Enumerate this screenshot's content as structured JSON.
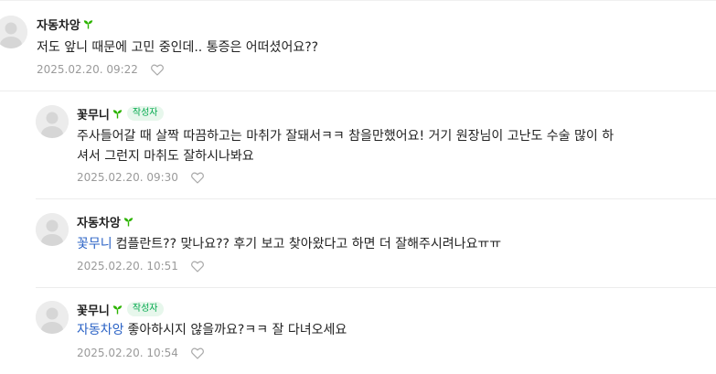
{
  "comments": [
    {
      "nickname": "자동차앙",
      "author_badge": "",
      "mention": "",
      "lines": [
        "저도 앞니 때문에 고민 중인데.. 통증은 어떠셨어요??"
      ],
      "date": "2025.02.20. 09:22"
    },
    {
      "nickname": "꽃무니",
      "author_badge": "작성자",
      "mention": "",
      "lines": [
        "주사들어갈 때 살짝 따끔하고는 마취가 잘돼서ㅋㅋ 참을만했어요! 거기 원장님이 고난도 수술 많이 하",
        "셔서 그런지 마취도 잘하시나봐요"
      ],
      "date": "2025.02.20. 09:30"
    },
    {
      "nickname": "자동차앙",
      "author_badge": "",
      "mention": "꽃무니",
      "lines": [
        "컴플란트?? 맞나요?? 후기 보고 찾아왔다고 하면 더 잘해주시려나요ㅠㅠ"
      ],
      "date": "2025.02.20. 10:51"
    },
    {
      "nickname": "꽃무니",
      "author_badge": "작성자",
      "mention": "자동차앙",
      "lines": [
        "좋아하시지 않을까요?ㅋㅋ 잘 다녀오세요"
      ],
      "date": "2025.02.20. 10:54"
    }
  ],
  "icons": {
    "like": "heart-outline-icon",
    "level": "sprout-icon",
    "avatar": "default-profile-icon"
  },
  "colors": {
    "badge_text": "#03a94d",
    "mention": "#2b63c6",
    "sprout": "#2db400"
  }
}
